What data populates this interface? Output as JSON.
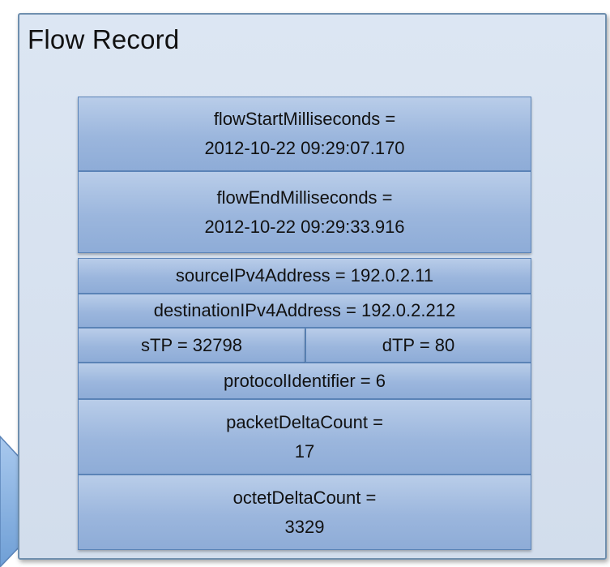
{
  "title": "Flow Record",
  "fields": {
    "flow_start": {
      "line1": "flowStartMilliseconds =",
      "line2": "2012-10-22 09:29:07.170"
    },
    "flow_end": {
      "line1": "flowEndMilliseconds =",
      "line2": "2012-10-22 09:29:33.916"
    },
    "source_ip": "sourceIPv4Address = 192.0.2.11",
    "destination_ip": "destinationIPv4Address = 192.0.2.212",
    "source_port": "sTP = 32798",
    "destination_port": "dTP = 80",
    "protocol": "protocolIdentifier = 6",
    "packet_count": {
      "line1": "packetDeltaCount =",
      "line2": "17"
    },
    "octet_count": {
      "line1": "octetDeltaCount =",
      "line2": "3329"
    }
  },
  "colors": {
    "record_fill": "#d6e0ee",
    "record_border": "#6f8fae",
    "field_fill": "#9bb6dd",
    "field_border": "#5b84b8",
    "arrow_fill": "#8fb6e3"
  }
}
